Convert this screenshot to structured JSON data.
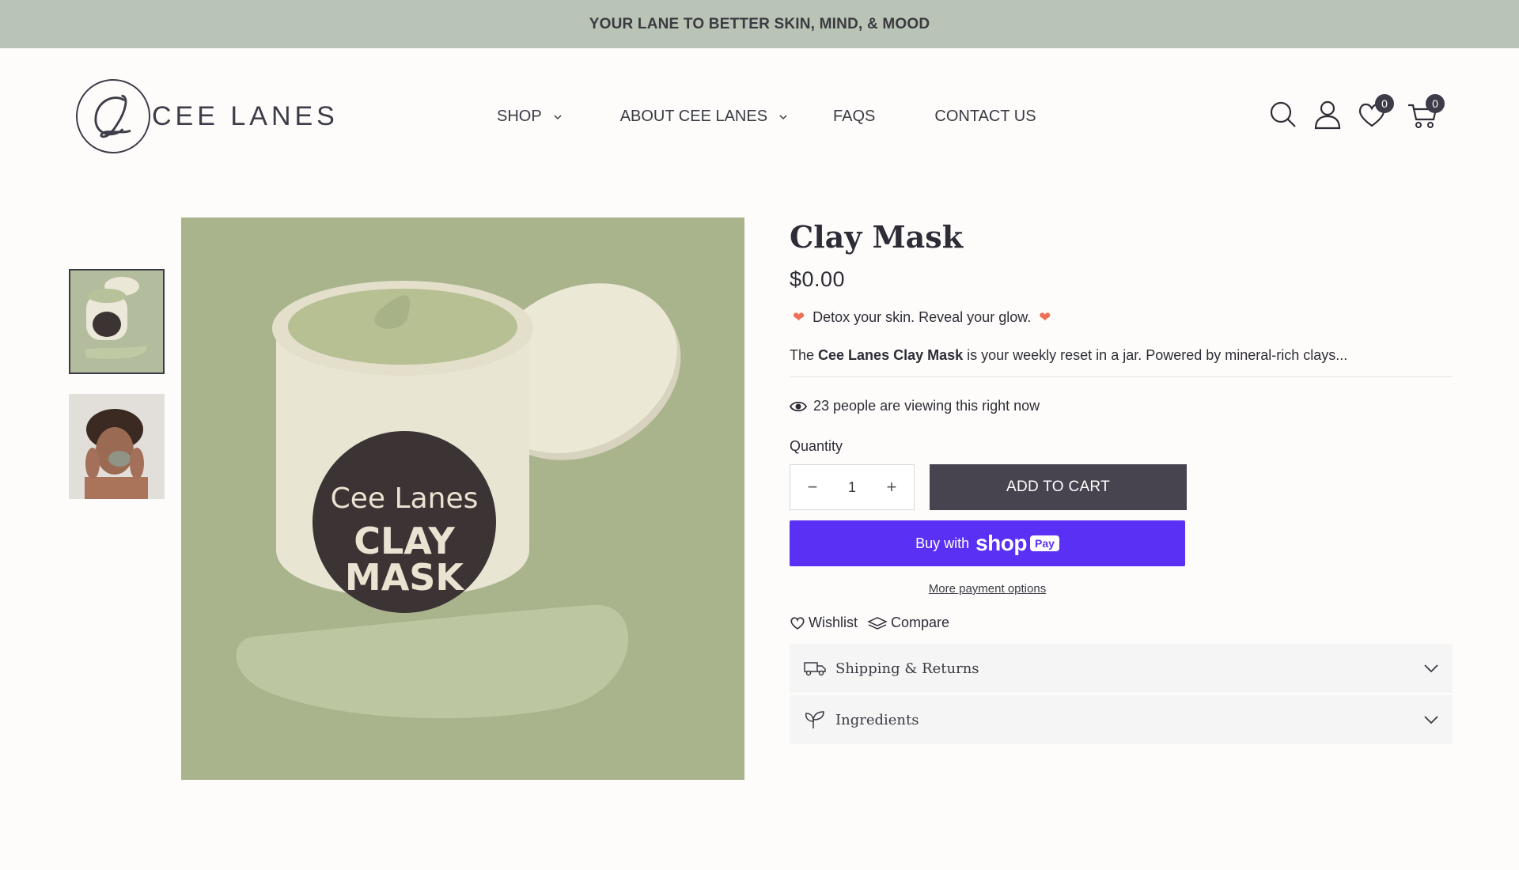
{
  "announcement": "YOUR LANE TO BETTER SKIN, MIND, & MOOD",
  "brand": {
    "monogram": "CL",
    "name": "CEE LANES"
  },
  "nav": [
    {
      "label": "SHOP"
    },
    {
      "label": "ABOUT CEE LANES"
    },
    {
      "label": "FAQS"
    },
    {
      "label": "CONTACT US"
    }
  ],
  "header_icons": {
    "search": "search-icon",
    "account": "user-icon",
    "wishlist": {
      "icon": "heart-icon",
      "count": "0"
    },
    "cart": {
      "icon": "cart-icon",
      "count": "0"
    }
  },
  "product": {
    "title": "Clay Mask",
    "price": "$0.00",
    "tagline": "Detox your skin. Reveal your glow.",
    "description_prefix": "The ",
    "description_bold": "Cee Lanes Clay Mask",
    "description_suffix": " is your weekly reset in a jar. Powered by mineral-rich clays...",
    "viewing": "23 people are viewing this right now",
    "quantity_label": "Quantity",
    "quantity_value": "1",
    "add_to_cart": "ADD TO CART",
    "shoppay_prefix": "Buy with",
    "shoppay_brand": "shop",
    "shoppay_pay": "Pay",
    "more_payment": "More payment options",
    "wishlist": "Wishlist",
    "compare": "Compare",
    "accordions": [
      {
        "label": "Shipping & Returns",
        "icon": "truck-icon"
      },
      {
        "label": "Ingredients",
        "icon": "leaf-icon"
      }
    ],
    "jar_label_brand": "Cee Lanes",
    "jar_label_product_line1": "CLAY",
    "jar_label_product_line2": "MASK"
  },
  "colors": {
    "announcement_bg": "#b9c4b7",
    "add_to_cart_bg": "#47434f",
    "shoppay_bg": "#5a31f4",
    "image_bg": "#a9b48d"
  }
}
